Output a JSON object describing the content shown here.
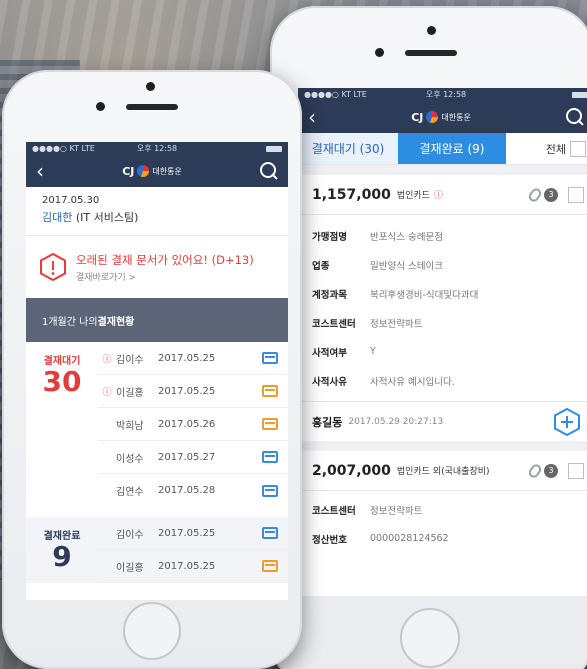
{
  "colors": {
    "navbar": "#2c3b57",
    "alert_red": "#e23c3c",
    "link_blue": "#2d66b6",
    "tab_active": "#2d8de0",
    "icon_blue": "#3a8ad6",
    "icon_orange": "#ef9a2b"
  },
  "left_phone": {
    "status": {
      "carrier": "●●●●○ KT  LTE",
      "time": "오후 12:58"
    },
    "nav": {
      "logo_cj": "CJ",
      "logo_text": "대한통운"
    },
    "user": {
      "date": "2017.05.30",
      "name": "김대한",
      "dept": "(IT 서비스팀)"
    },
    "alert": {
      "message": "오래된 결재 문서가 있어요! (D+13)",
      "link": "결재바로가기 >"
    },
    "section": {
      "prefix": "1개월간 나의 ",
      "bold": "결재현황"
    },
    "pending": {
      "label": "결재대기",
      "count": "30",
      "rows": [
        {
          "mark": "ⓘ",
          "name": "김이수",
          "date": "2017.05.25",
          "icon": "blue"
        },
        {
          "mark": "ⓘ",
          "name": "이길홍",
          "date": "2017.05.25",
          "icon": "orange"
        },
        {
          "mark": "",
          "name": "박희남",
          "date": "2017.05.26",
          "icon": "orange"
        },
        {
          "mark": "",
          "name": "이성수",
          "date": "2017.05.27",
          "icon": "blue"
        },
        {
          "mark": "",
          "name": "김연수",
          "date": "2017.05.28",
          "icon": "blue"
        }
      ]
    },
    "done": {
      "label": "결재완료",
      "count": "9",
      "rows": [
        {
          "mark": "",
          "name": "김이수",
          "date": "2017.05.25",
          "icon": "blue"
        },
        {
          "mark": "",
          "name": "이길홍",
          "date": "2017.05.25",
          "icon": "orange"
        }
      ]
    }
  },
  "right_phone": {
    "status": {
      "carrier": "●●●●○ KT  LTE",
      "time": "오후 12:58"
    },
    "nav": {
      "logo_cj": "CJ",
      "logo_text": "대한통운"
    },
    "tabs": {
      "wait": "결재대기 (30)",
      "done": "결재완료 (9)",
      "all": "전체"
    },
    "card1": {
      "amount": "1,157,000",
      "type": "법인카드",
      "warn": "ⓘ",
      "attach_count": "3",
      "fields": [
        {
          "k": "가맹점명",
          "v": "반포식스 숭례문점"
        },
        {
          "k": "업종",
          "v": "일반양식 스테이크"
        },
        {
          "k": "계정과목",
          "v": "복리후생경비-식대및다과대"
        },
        {
          "k": "코스트센터",
          "v": "정보전략파트"
        },
        {
          "k": "사적여부",
          "v": "Y"
        },
        {
          "k": "사적사유",
          "v": "사적사유 예시입니다."
        }
      ],
      "approver": "홍길동",
      "timestamp": "2017.05.29  20:27:13"
    },
    "card2": {
      "amount": "2,007,000",
      "type": "법인카드 외(국내출장비)",
      "attach_count": "3",
      "fields": [
        {
          "k": "코스트센터",
          "v": "정보전략파트"
        },
        {
          "k": "정산번호",
          "v": "0000028124562"
        }
      ]
    }
  }
}
